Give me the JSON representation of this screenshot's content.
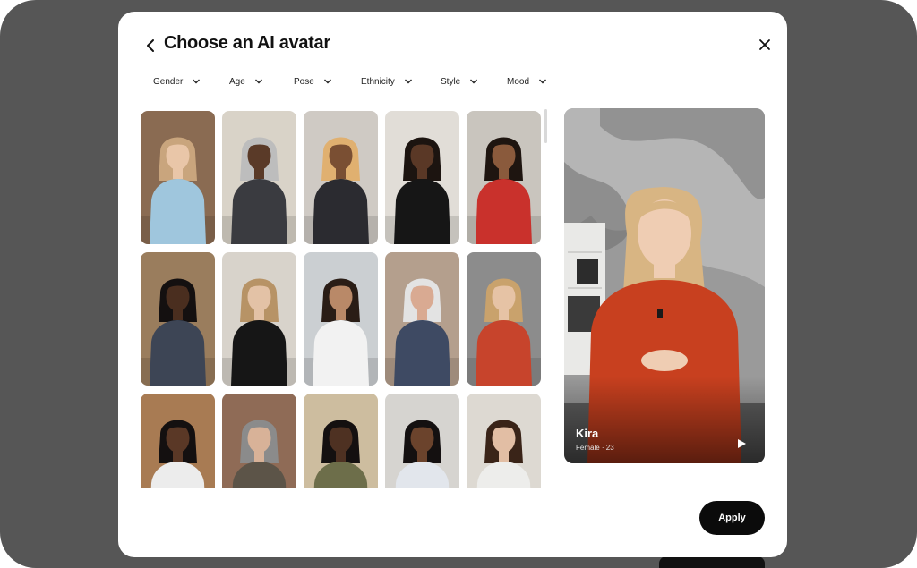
{
  "modal": {
    "title": "Choose an AI avatar"
  },
  "filters": [
    {
      "label": "Gender"
    },
    {
      "label": "Age"
    },
    {
      "label": "Pose"
    },
    {
      "label": "Ethnicity"
    },
    {
      "label": "Style"
    },
    {
      "label": "Mood"
    }
  ],
  "avatars": [
    {
      "bg": "#8a6b52",
      "skin": "#e9c6a8",
      "hair": "#c9a57d",
      "outfit": "#9fc6dd"
    },
    {
      "bg": "#d9d3c8",
      "skin": "#5a3a28",
      "hair": "#bdbdbd",
      "outfit": "#3a3b40"
    },
    {
      "bg": "#cfcac4",
      "skin": "#7a4f33",
      "hair": "#e0b070",
      "outfit": "#2b2b30"
    },
    {
      "bg": "#e1ddd7",
      "skin": "#5a3826",
      "hair": "#1c1410",
      "outfit": "#161616"
    },
    {
      "bg": "#c9c5be",
      "skin": "#8a5a3c",
      "hair": "#1e1510",
      "outfit": "#c9312c"
    },
    {
      "bg": "#9a7d5d",
      "skin": "#4a2e1f",
      "hair": "#141010",
      "outfit": "#3d4555"
    },
    {
      "bg": "#d8d3cb",
      "skin": "#e3c2a6",
      "hair": "#b79366",
      "outfit": "#161616"
    },
    {
      "bg": "#cbcfd2",
      "skin": "#b98968",
      "hair": "#2a1d16",
      "outfit": "#f2f2f2"
    },
    {
      "bg": "#b49f8d",
      "skin": "#d9aa92",
      "hair": "#e3e3e3",
      "outfit": "#3e4a63"
    },
    {
      "bg": "#8c8c8c",
      "skin": "#e6c3a5",
      "hair": "#c9a26c",
      "outfit": "#c7442c"
    },
    {
      "bg": "#a87b53",
      "skin": "#5a3826",
      "hair": "#141010",
      "outfit": "#ececec"
    },
    {
      "bg": "#8f6b56",
      "skin": "#d8b298",
      "hair": "#8b8b8b",
      "outfit": "#5c5448"
    },
    {
      "bg": "#cdbd9f",
      "skin": "#4e3122",
      "hair": "#141010",
      "outfit": "#6d6e4a"
    },
    {
      "bg": "#d6d4d0",
      "skin": "#6b432c",
      "hair": "#141010",
      "outfit": "#e2e6ec"
    },
    {
      "bg": "#ddd9d2",
      "skin": "#e2bea4",
      "hair": "#3a2418",
      "outfit": "#ededeb"
    }
  ],
  "preview": {
    "name": "Kira",
    "meta": "Female · 23",
    "skin": "#efcdb3",
    "hair": "#d8b583",
    "outfit": "#c8401f"
  },
  "actions": {
    "apply_label": "Apply"
  },
  "icons": {
    "back": "chevron-left-icon",
    "close": "close-icon",
    "dropdown": "chevron-down-icon",
    "play": "play-icon"
  }
}
